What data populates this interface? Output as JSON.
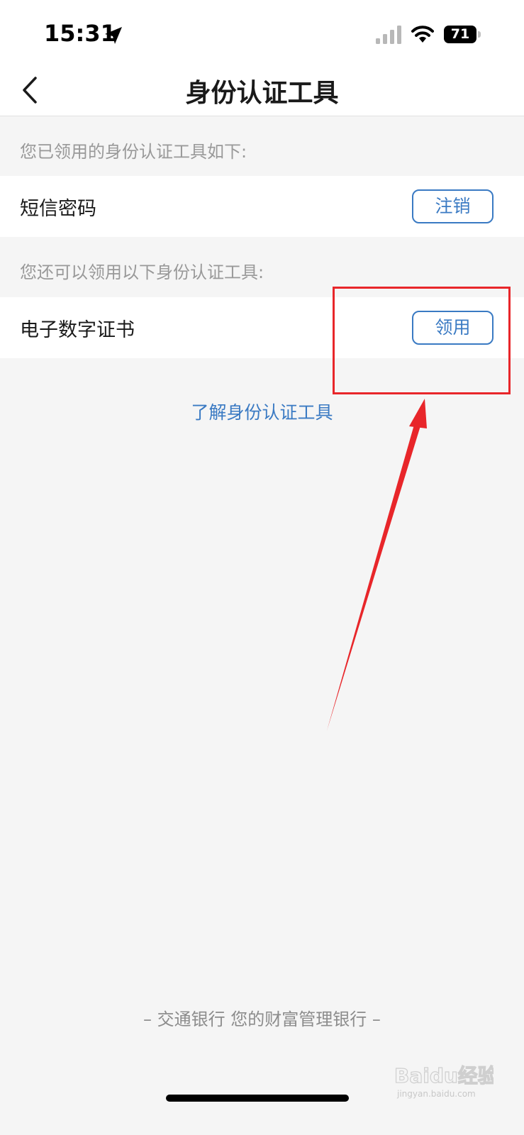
{
  "status_bar": {
    "time": "15:31",
    "battery": "71",
    "icons": [
      "location-arrow-icon",
      "signal-icon",
      "wifi-icon",
      "battery-icon"
    ]
  },
  "header": {
    "title": "身份认证工具",
    "back_icon": "chevron-left-icon"
  },
  "sections": {
    "owned_label": "您已领用的身份认证工具如下:",
    "available_label": "您还可以领用以下身份认证工具:"
  },
  "owned_tools": [
    {
      "name": "短信密码",
      "action": "注销"
    }
  ],
  "available_tools": [
    {
      "name": "电子数字证书",
      "action": "领用"
    }
  ],
  "learn_more_link": "了解身份认证工具",
  "footer": "– 交通银行 您的财富管理银行 –",
  "watermark": {
    "text": "Baidu经验",
    "sub": "jingyan.baidu.com"
  },
  "colors": {
    "accent": "#3a7ac3",
    "annotation": "#e8262a",
    "background": "#f5f5f5"
  }
}
